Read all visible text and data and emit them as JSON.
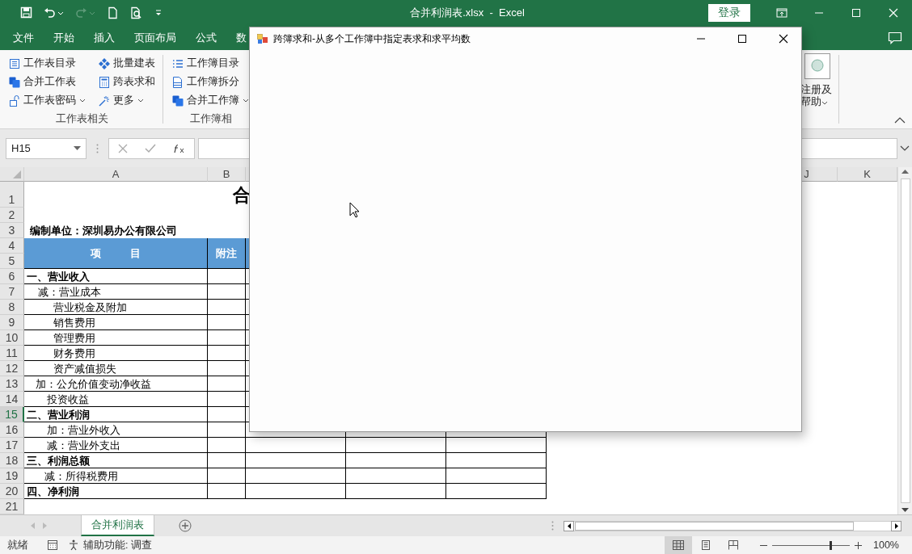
{
  "title_bar": {
    "title": "合并利润表.xlsx  -  Excel",
    "sign_in_button": "登录",
    "quick_access": [
      {
        "disabled": false
      },
      {
        "disabled": false
      },
      {
        "disabled": true
      },
      {
        "disabled": false
      },
      {
        "disabled": false
      }
    ]
  },
  "menu_tabs": [
    {
      "label": "文件",
      "selected": false
    },
    {
      "label": "开始",
      "selected": false
    },
    {
      "label": "插入",
      "selected": false
    },
    {
      "label": "页面布局",
      "selected": false
    },
    {
      "label": "公式",
      "selected": false
    },
    {
      "label": "数",
      "selected": false
    }
  ],
  "ribbon": {
    "groups": [
      {
        "label": "工作表相关",
        "buttons": [
          {
            "label": "工作表目录",
            "dropdown": false
          },
          {
            "label": "批量建表",
            "dropdown": false
          },
          {
            "label": "合并工作表",
            "dropdown": false
          },
          {
            "label": "跨表求和",
            "dropdown": false
          },
          {
            "label": "工作表密码",
            "dropdown": true
          },
          {
            "label": "更多",
            "dropdown": true
          }
        ]
      },
      {
        "label": "工作簿相",
        "buttons": [
          {
            "label": "工作簿目录",
            "dropdown": false
          },
          {
            "label": "工作簿拆分",
            "dropdown": false
          },
          {
            "label": "合并工作簿",
            "dropdown": true
          }
        ]
      }
    ],
    "help_button": {
      "label": "注册及帮助",
      "dropdown": true
    }
  },
  "formula_bar": {
    "name_box": "H15"
  },
  "sheet": {
    "columns": [
      {
        "label": "A"
      },
      {
        "label": "B"
      },
      {
        "label": "J"
      },
      {
        "label": "K"
      }
    ],
    "rows": [
      {
        "label": "1",
        "selected": false
      },
      {
        "label": "2",
        "selected": false
      },
      {
        "label": "3",
        "selected": false
      },
      {
        "label": "4",
        "selected": false
      },
      {
        "label": "5",
        "selected": false
      },
      {
        "label": "6",
        "selected": false
      },
      {
        "label": "7",
        "selected": false
      },
      {
        "label": "8",
        "selected": false
      },
      {
        "label": "9",
        "selected": false
      },
      {
        "label": "10",
        "selected": false
      },
      {
        "label": "11",
        "selected": false
      },
      {
        "label": "12",
        "selected": false
      },
      {
        "label": "13",
        "selected": false
      },
      {
        "label": "14",
        "selected": false
      },
      {
        "label": "15",
        "selected": true
      },
      {
        "label": "16",
        "selected": false
      },
      {
        "label": "17",
        "selected": false
      },
      {
        "label": "18",
        "selected": false
      },
      {
        "label": "19",
        "selected": false
      },
      {
        "label": "20",
        "selected": false
      },
      {
        "label": "21",
        "selected": false
      }
    ],
    "title": "合",
    "unit": "编制单位：深圳易办公有限公司",
    "header": [
      "项          目",
      "附注"
    ],
    "items": [
      {
        "label": "一、营业收入",
        "bold": true
      },
      {
        "label": "    减：营业成本",
        "bold": false
      },
      {
        "label": "         营业税金及附加",
        "bold": false
      },
      {
        "label": "         销售费用",
        "bold": false
      },
      {
        "label": "         管理费用",
        "bold": false
      },
      {
        "label": "         财务费用",
        "bold": false
      },
      {
        "label": "         资产减值损失",
        "bold": false
      },
      {
        "label": "   加：公允价值变动净收益",
        "bold": false
      },
      {
        "label": "       投资收益",
        "bold": false
      },
      {
        "label": "二、营业利润",
        "bold": true
      },
      {
        "label": "       加：营业外收入",
        "bold": false
      },
      {
        "label": "       减：营业外支出",
        "bold": false
      },
      {
        "label": "三、利润总额",
        "bold": true
      },
      {
        "label": "      减：所得税费用",
        "bold": false
      },
      {
        "label": "四、净利润",
        "bold": true
      }
    ]
  },
  "dialog": {
    "title": "跨簿求和-从多个工作簿中指定表求和求平均数"
  },
  "sheet_tabs": [
    {
      "label": "合并利润表",
      "selected": true
    }
  ],
  "status_bar": {
    "status": "就绪",
    "accessibility": "辅助功能: 调查",
    "views": [
      {
        "selected": true
      },
      {
        "selected": false
      },
      {
        "selected": false
      }
    ],
    "zoom": {
      "level": 0.75,
      "reading": "100%"
    }
  }
}
